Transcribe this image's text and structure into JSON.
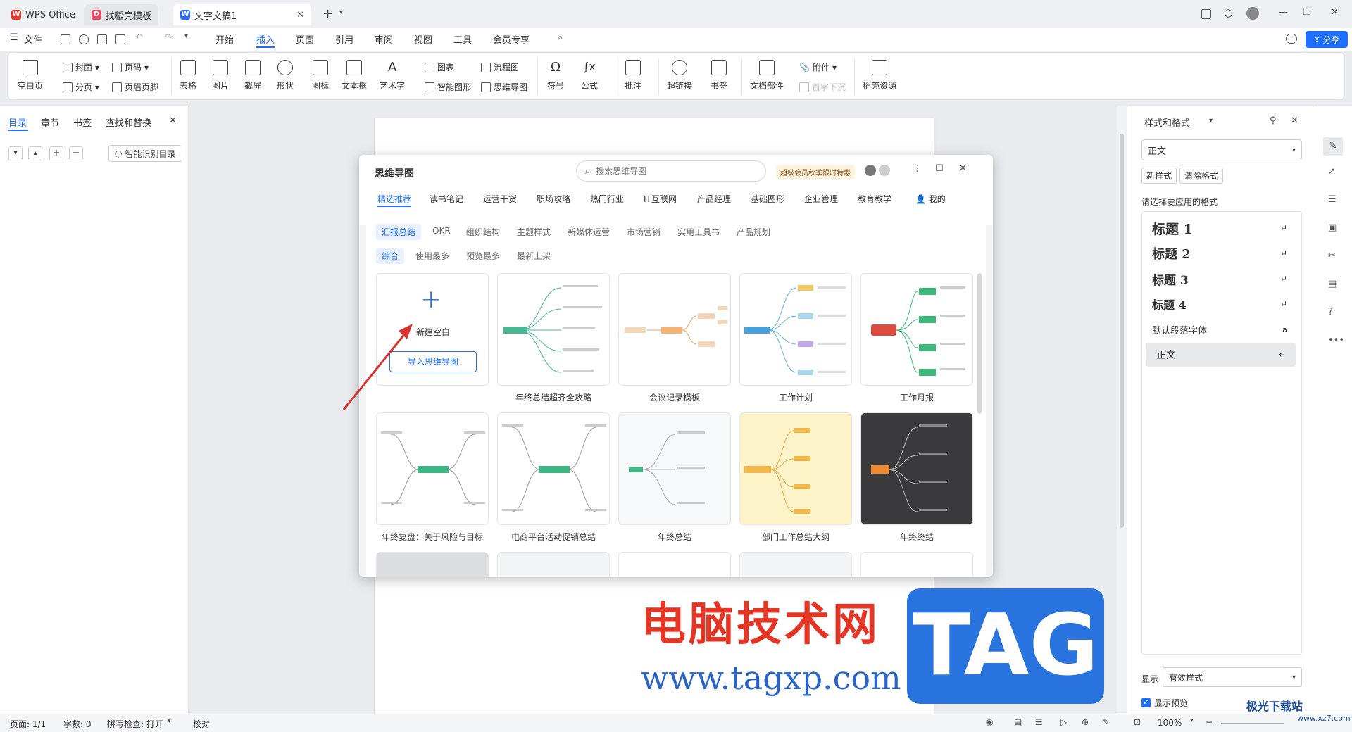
{
  "tabs": [
    {
      "label": "WPS Office"
    },
    {
      "label": "找稻壳模板"
    },
    {
      "label": "文字文稿1"
    }
  ],
  "menu": {
    "file": "文件",
    "items": [
      "开始",
      "插入",
      "页面",
      "引用",
      "审阅",
      "视图",
      "工具",
      "会员专享"
    ],
    "active": "插入",
    "share": "分享"
  },
  "ribbon": {
    "blank_page": "空白页",
    "cover": "封面",
    "page_number": "页码",
    "page_break": "分页",
    "header_footer": "页眉页脚",
    "table": "表格",
    "picture": "图片",
    "screenshot": "截屏",
    "shape": "形状",
    "icon": "图标",
    "textbox": "文本框",
    "wordart": "艺术字",
    "chart": "图表",
    "flowchart": "流程图",
    "smart_graphic": "智能图形",
    "mindmap": "思维导图",
    "symbol": "符号",
    "formula": "公式",
    "comment": "批注",
    "hyperlink": "超链接",
    "bookmark": "书签",
    "doc_parts": "文档部件",
    "attachment": "附件",
    "drop_cap": "首字下沉",
    "docer": "稻壳资源"
  },
  "leftpanel": {
    "tabs": [
      "目录",
      "章节",
      "书签",
      "查找和替换"
    ],
    "smart_toc": "智能识别目录"
  },
  "rightpanel": {
    "title": "样式和格式",
    "current_style": "正文",
    "new_style": "新样式",
    "clear_format": "清除格式",
    "prompt": "请选择要应用的格式",
    "styles": [
      "标题 1",
      "标题 2",
      "标题 3",
      "标题 4",
      "默认段落字体",
      "正文"
    ],
    "show_label": "显示",
    "show_value": "有效样式",
    "preview_label": "显示预览"
  },
  "status": {
    "page": "页面: 1/1",
    "words": "字数: 0",
    "spell": "拼写检查: 打开",
    "proof": "校对",
    "zoom": "100%"
  },
  "dialog": {
    "title": "思维导图",
    "search_placeholder": "搜索思维导图",
    "promo": "超级会员秋季限时特惠",
    "categories": [
      "精选推荐",
      "读书笔记",
      "运营干货",
      "职场攻略",
      "热门行业",
      "IT互联网",
      "产品经理",
      "基础图形",
      "企业管理",
      "教育教学",
      "我的"
    ],
    "subcats": [
      "汇报总结",
      "OKR",
      "组织结构",
      "主题样式",
      "新媒体运营",
      "市场营销",
      "实用工具书",
      "产品规划"
    ],
    "sorts": [
      "综合",
      "使用最多",
      "预览最多",
      "最新上架"
    ],
    "new_blank": "新建空白",
    "import": "导入思维导图",
    "cards": [
      "年终总结超齐全攻略",
      "会议记录模板",
      "工作计划",
      "工作月报",
      "年终复盘：关于风险与目标",
      "电商平台活动促销总结",
      "年终总结",
      "部门工作总结大纲",
      "年终终结"
    ]
  },
  "watermark": {
    "text1": "电脑技术网",
    "text2": "www.tagxp.com",
    "tag": "TAG",
    "brand": "极光下载站",
    "brand_url": "www.xz7.com"
  }
}
